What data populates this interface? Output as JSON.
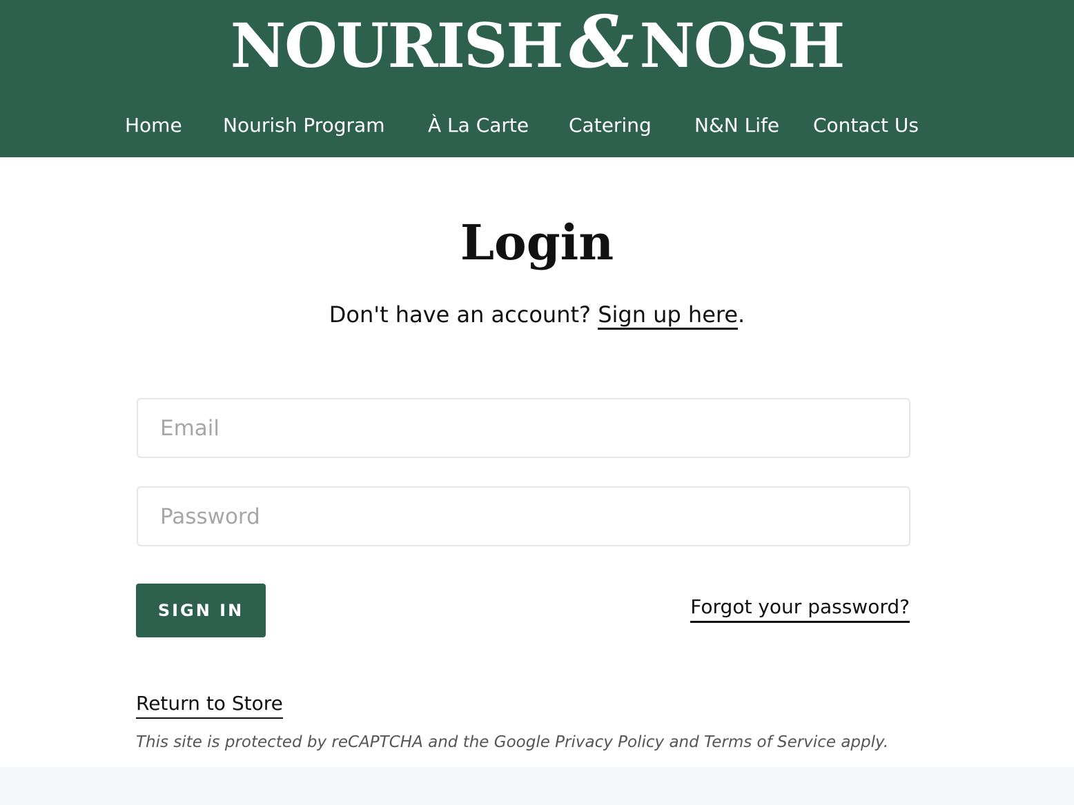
{
  "header": {
    "logo": {
      "part1": "NOURISH",
      "ampersand": "&",
      "part2": "NOSH"
    },
    "nav": [
      {
        "label": "Home"
      },
      {
        "label": "Nourish Program"
      },
      {
        "label": "À La Carte"
      },
      {
        "label": "Catering"
      },
      {
        "label": "N&N Life"
      },
      {
        "label": "Contact Us"
      }
    ]
  },
  "main": {
    "title": "Login",
    "signup_prompt": "Don't have an account? ",
    "signup_link": "Sign up here",
    "signup_suffix": ".",
    "email": {
      "placeholder": "Email",
      "value": ""
    },
    "password": {
      "placeholder": "Password",
      "value": ""
    },
    "sign_in_label": "SIGN IN",
    "forgot_password": "Forgot your password?",
    "return_to_store": "Return to Store",
    "recaptcha_notice": "This site is protected by reCAPTCHA and the Google Privacy Policy and Terms of Service apply."
  },
  "colors": {
    "brand_green": "#2e614d",
    "footer_band": "#f6f7f8"
  }
}
